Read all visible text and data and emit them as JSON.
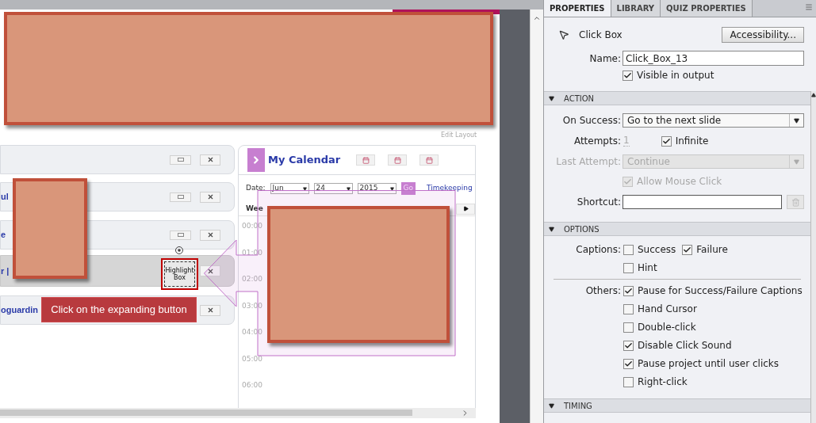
{
  "stage": {
    "edit_layout": "Edit Layout",
    "rows": [
      {
        "highlighted": false
      },
      {
        "title": "ul",
        "highlighted": false
      },
      {
        "title": "e",
        "highlighted": false
      },
      {
        "title": "r |",
        "highlighted": true
      },
      {
        "title": "oguardin",
        "highlighted": false
      }
    ],
    "highlight_box": {
      "label": "Highlight Box"
    },
    "caption": "Click on the expanding button",
    "calendar": {
      "title": "My Calendar",
      "date_label": "Date:",
      "month": "Jun",
      "day": "24",
      "year": "2015",
      "go": "Go",
      "link": "Timekeeping",
      "week_label": "Wee",
      "times": [
        "00:00",
        "01:00",
        "02:00",
        "03:00",
        "04:00",
        "05:00",
        "06:00"
      ]
    }
  },
  "panel": {
    "tabs": [
      {
        "label": "PROPERTIES",
        "selected": true
      },
      {
        "label": "LIBRARY",
        "selected": false
      },
      {
        "label": "QUIZ PROPERTIES",
        "selected": false
      }
    ],
    "object_type": "Click Box",
    "accessibility_button": "Accessibility...",
    "name_label": "Name:",
    "name_value": "Click_Box_13",
    "visible": {
      "label": "Visible in output",
      "checked": true
    },
    "action": {
      "title": "ACTION",
      "expanded": true,
      "on_success": {
        "label": "On Success:",
        "value": "Go to the next slide"
      },
      "attempts": {
        "label": "Attempts:",
        "value": "1"
      },
      "infinite": {
        "label": "Infinite",
        "checked": true
      },
      "last_attempt": {
        "label": "Last Attempt:",
        "value": "Continue",
        "disabled": true
      },
      "allow_mouse_click": {
        "label": "Allow Mouse Click",
        "checked": true,
        "disabled": true
      },
      "shortcut": {
        "label": "Shortcut:"
      }
    },
    "options": {
      "title": "OPTIONS",
      "expanded": true,
      "captions_label": "Captions:",
      "captions": [
        {
          "label": "Success",
          "checked": false
        },
        {
          "label": "Failure",
          "checked": true
        },
        {
          "label": "Hint",
          "checked": false
        }
      ],
      "others_label": "Others:",
      "others": [
        {
          "label": "Pause for Success/Failure Captions",
          "checked": true
        },
        {
          "label": "Hand Cursor",
          "checked": false
        },
        {
          "label": "Double-click",
          "checked": false
        },
        {
          "label": "Disable Click Sound",
          "checked": true
        },
        {
          "label": "Pause project until user clicks",
          "checked": true
        },
        {
          "label": "Right-click",
          "checked": false
        }
      ]
    },
    "timing": {
      "title": "TIMING",
      "expanded": true
    }
  }
}
